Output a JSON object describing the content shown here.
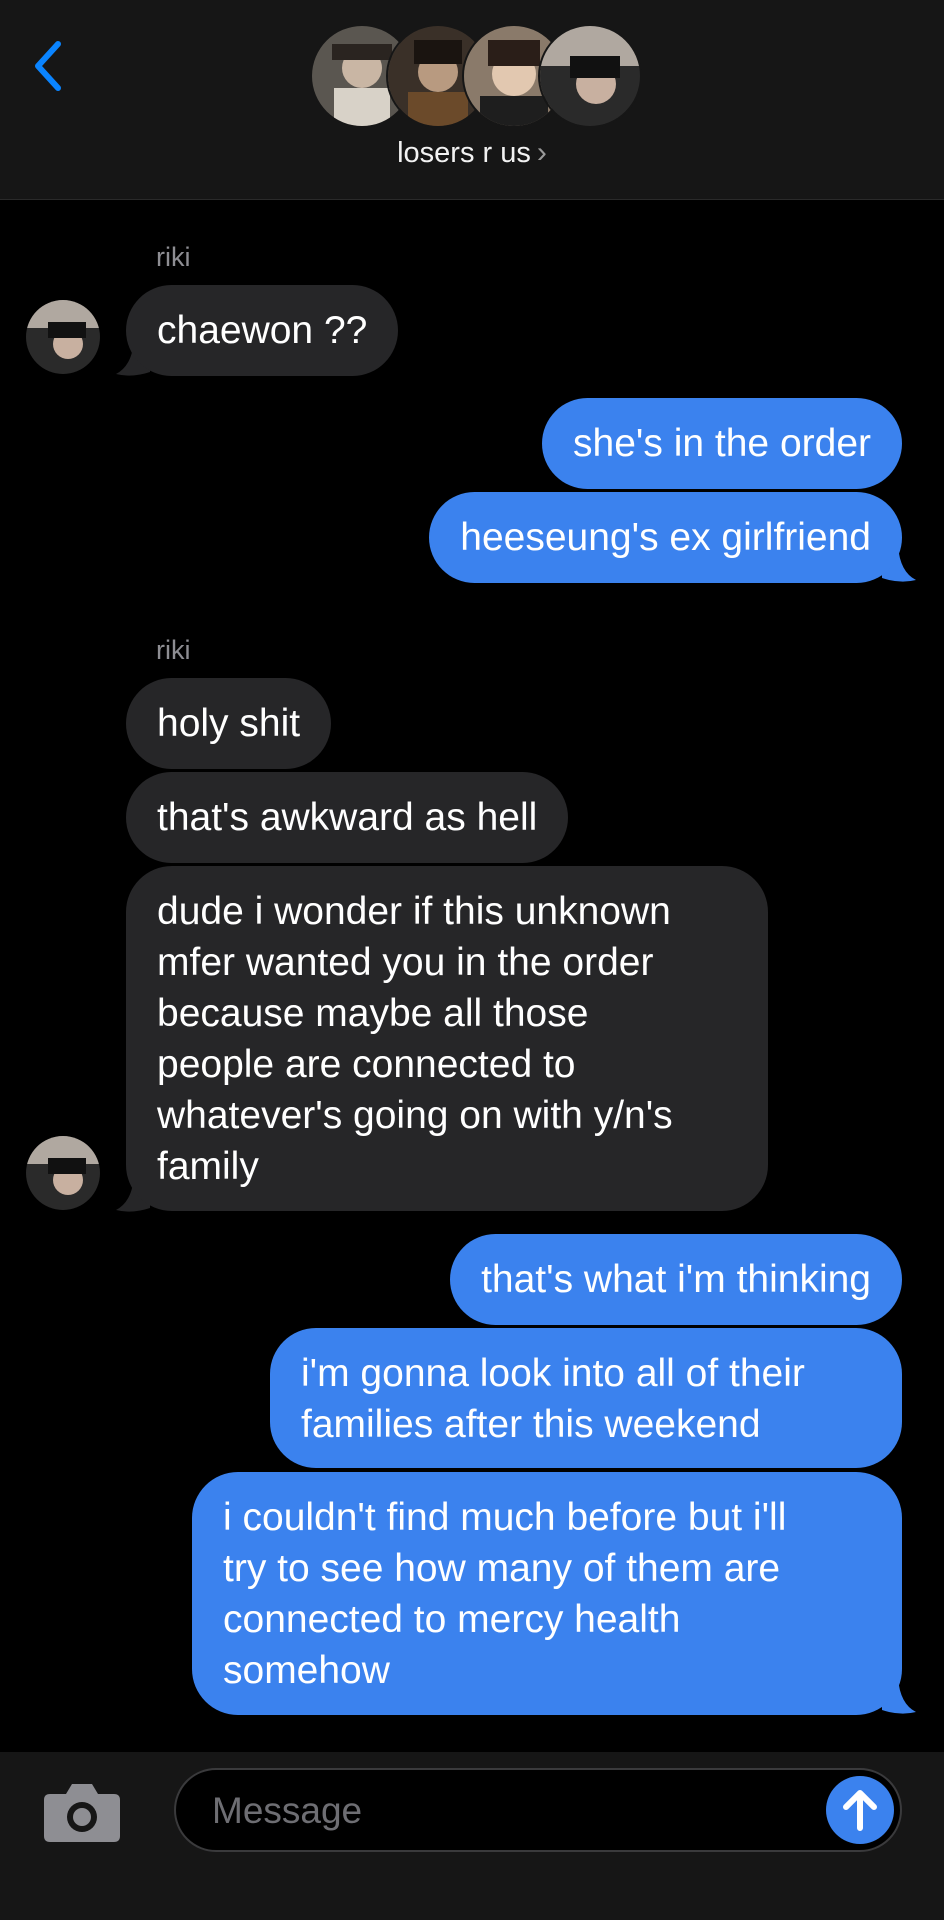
{
  "header": {
    "group_name": "losers r us",
    "chevron": "›",
    "back_icon": "chevron-left-icon",
    "accent": "#0a84ff"
  },
  "messages": [
    {
      "sender": "riki"
    },
    {
      "text": "chaewon ??"
    },
    {
      "text": "she's in the order"
    },
    {
      "text": "heeseung's ex girlfriend"
    },
    {
      "sender": "riki"
    },
    {
      "text": "holy shit"
    },
    {
      "text": "that's awkward as hell"
    },
    {
      "lines": [
        "dude i wonder if this unknown",
        "mfer wanted you in the order",
        "because maybe all those",
        "people are connected to",
        "whatever's going on with y/n's",
        "family"
      ]
    },
    {
      "text": "that's what i'm thinking"
    },
    {
      "lines": [
        "i'm gonna look into all of their",
        "families after this weekend"
      ]
    },
    {
      "lines": [
        "i couldn't find much before but i'll",
        "try to see how many of them are",
        "connected to mercy health",
        "somehow"
      ]
    }
  ],
  "composer": {
    "placeholder": "Message",
    "camera_icon": "camera-icon",
    "send_icon": "arrow-up-icon"
  },
  "colors": {
    "incoming_bubble": "#262628",
    "outgoing_bubble": "#3b82ee",
    "background": "#000000"
  }
}
